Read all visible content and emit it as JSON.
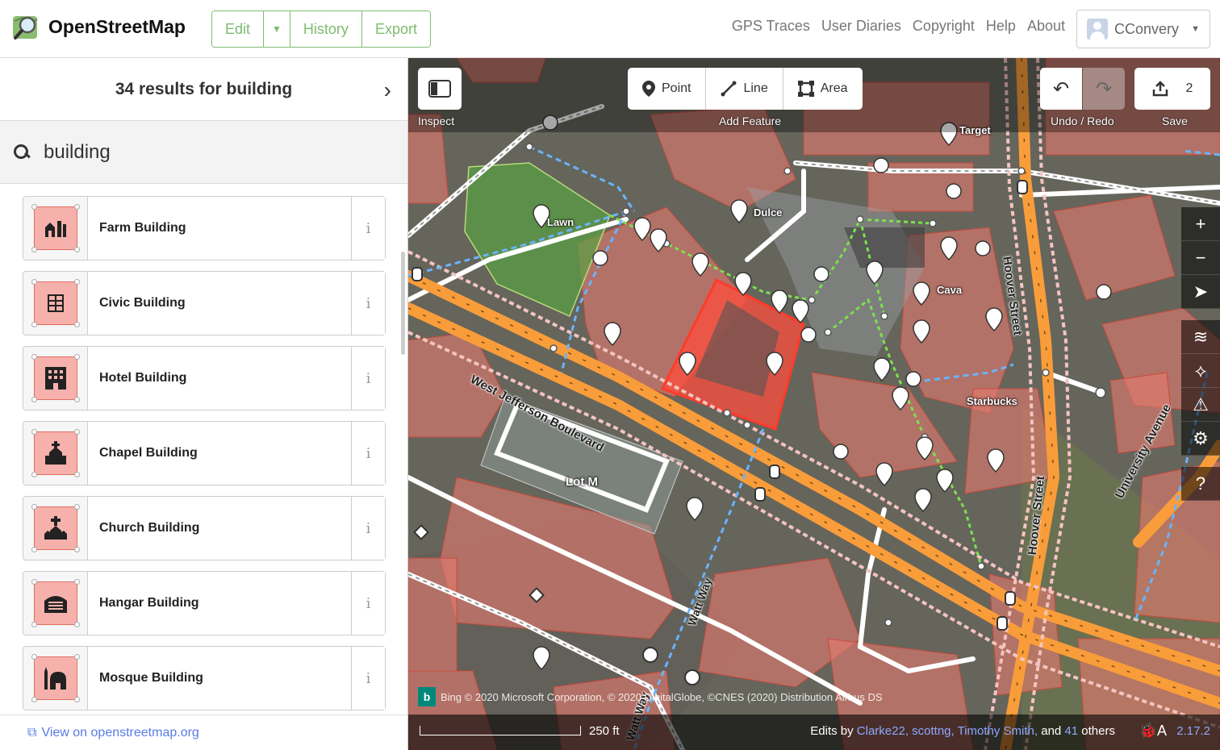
{
  "header": {
    "logo_text": "OpenStreetMap",
    "edit_label": "Edit",
    "history_label": "History",
    "export_label": "Export",
    "links": [
      "GPS Traces",
      "User Diaries",
      "Copyright",
      "Help",
      "About"
    ],
    "user_name": "CConvery"
  },
  "sidebar": {
    "results_title": "34 results for building",
    "search_value": "building",
    "presets": [
      {
        "label": "Farm Building",
        "icon": "farm-building-icon"
      },
      {
        "label": "Civic Building",
        "icon": "civic-building-icon"
      },
      {
        "label": "Hotel Building",
        "icon": "hotel-building-icon"
      },
      {
        "label": "Chapel Building",
        "icon": "chapel-building-icon"
      },
      {
        "label": "Church Building",
        "icon": "church-building-icon"
      },
      {
        "label": "Hangar Building",
        "icon": "hangar-building-icon"
      },
      {
        "label": "Mosque Building",
        "icon": "mosque-building-icon"
      }
    ],
    "footer_link": "View on openstreetmap.org"
  },
  "map_toolbar": {
    "inspect_label": "Inspect",
    "point_label": "Point",
    "line_label": "Line",
    "area_label": "Area",
    "add_feature_label": "Add Feature",
    "undo_redo_label": "Undo / Redo",
    "save_label": "Save",
    "save_count": "2"
  },
  "map_labels": {
    "lawn": "Lawn",
    "dulce": "Dulce",
    "cava": "Cava",
    "target": "Target",
    "starbucks": "Starbucks",
    "lot_m": "Lot M",
    "west_jefferson": "West Jefferson Boulevard",
    "hoover_street_1": "Hoover Street",
    "hoover_street_2": "Hoover Street",
    "university_avenue": "University Avenue",
    "watt_way_1": "Watt Way",
    "watt_way_2": "Watt Way"
  },
  "map_footer": {
    "attribution": "Bing  © 2020 Microsoft Corporation, © 2020 DigitalGlobe, ©CNES (2020) Distribution Airbus DS",
    "bing_label": "b",
    "scale": "250 ft",
    "edits_prefix": "Edits by",
    "editors": "Clarke22, scottng, Timothy Smith,",
    "edits_and": "and",
    "others_count": "41",
    "edits_suffix": "others",
    "version": "2.17.2"
  },
  "colors": {
    "osm_green": "#7ebc6f",
    "building_fill": "#e06e5f",
    "road_orange": "#f99d3a",
    "link_blue": "#597be7"
  }
}
